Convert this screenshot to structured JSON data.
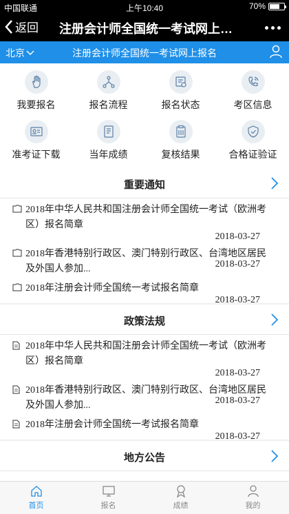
{
  "status": {
    "carrier": "中国联通",
    "time": "上午10:40",
    "battery": "70%",
    "battery_level": 0.7
  },
  "nav": {
    "back_label": "返回",
    "title": "注册会计师全国统一考试网上…"
  },
  "topbar": {
    "city": "北京",
    "title": "注册会计师全国统一考试网上报名"
  },
  "grid": [
    {
      "label": "我要报名",
      "icon": "hand-icon"
    },
    {
      "label": "报名流程",
      "icon": "flow-icon"
    },
    {
      "label": "报名状态",
      "icon": "status-icon"
    },
    {
      "label": "考区信息",
      "icon": "phone-icon"
    },
    {
      "label": "准考证下载",
      "icon": "id-card-icon"
    },
    {
      "label": "当年成绩",
      "icon": "score-icon"
    },
    {
      "label": "复核结果",
      "icon": "clipboard-icon"
    },
    {
      "label": "合格证验证",
      "icon": "shield-icon"
    }
  ],
  "notices": {
    "title": "重要通知",
    "items": [
      {
        "text": "2018年中华人民共和国注册会计师全国统一考试（欧洲考区）报名简章",
        "date": "2018-03-27"
      },
      {
        "text": "2018年香港特别行政区、澳门特别行政区、台湾地区居民及外国人参加...",
        "date": "2018-03-27"
      },
      {
        "text": "2018年注册会计师全国统一考试报名简章",
        "date": "2018-03-27"
      }
    ]
  },
  "policies": {
    "title": "政策法规",
    "items": [
      {
        "text": "2018年中华人民共和国注册会计师全国统一考试（欧洲考区）报名简章",
        "date": "2018-03-27"
      },
      {
        "text": "2018年香港特别行政区、澳门特别行政区、台湾地区居民及外国人参加...",
        "date": "2018-03-27"
      },
      {
        "text": "2018年注册会计师全国统一考试报名简章",
        "date": "2018-03-27"
      }
    ]
  },
  "local": {
    "title": "地方公告"
  },
  "tabs": [
    {
      "label": "首页",
      "icon": "home-icon"
    },
    {
      "label": "报名",
      "icon": "monitor-icon"
    },
    {
      "label": "成绩",
      "icon": "award-icon"
    },
    {
      "label": "我的",
      "icon": "person-icon"
    }
  ],
  "colors": {
    "accent": "#1f8fe8",
    "nav_bg": "#000000",
    "page_bg": "#efeff4"
  }
}
